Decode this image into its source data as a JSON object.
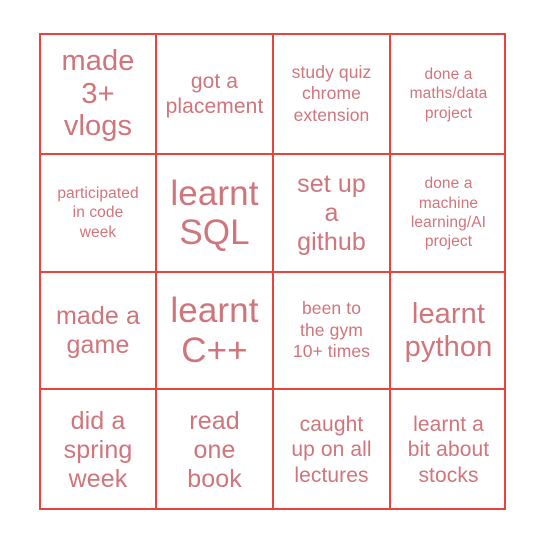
{
  "card": {
    "type": "bingo-card",
    "rows": 4,
    "columns": 4,
    "colors": {
      "grid_line": "#e8433f",
      "text": "#cf757c",
      "background": "#ffffff"
    },
    "cells": [
      {
        "text": "made\n3+\nvlogs",
        "size": "sz-lg"
      },
      {
        "text": "got a\nplacement",
        "size": "sz-sm"
      },
      {
        "text": "study quiz\nchrome\nextension",
        "size": "sz-xs"
      },
      {
        "text": "done a\nmaths/data\nproject",
        "size": "sz-xxs"
      },
      {
        "text": "participated\nin code\nweek",
        "size": "sz-xxs"
      },
      {
        "text": "learnt\nSQL",
        "size": "sz-xl"
      },
      {
        "text": "set up\na\ngithub",
        "size": "sz-md"
      },
      {
        "text": "done a\nmachine\nlearning/AI\nproject",
        "size": "sz-xxs"
      },
      {
        "text": "made a\ngame",
        "size": "sz-md"
      },
      {
        "text": "learnt\nC++",
        "size": "sz-xl"
      },
      {
        "text": "been to\nthe gym\n10+ times",
        "size": "sz-xs"
      },
      {
        "text": "learnt\npython",
        "size": "sz-lg"
      },
      {
        "text": "did a\nspring\nweek",
        "size": "sz-md"
      },
      {
        "text": "read\none\nbook",
        "size": "sz-md"
      },
      {
        "text": "caught\nup on all\nlectures",
        "size": "sz-sm"
      },
      {
        "text": "learnt a\nbit about\nstocks",
        "size": "sz-sm"
      }
    ]
  }
}
